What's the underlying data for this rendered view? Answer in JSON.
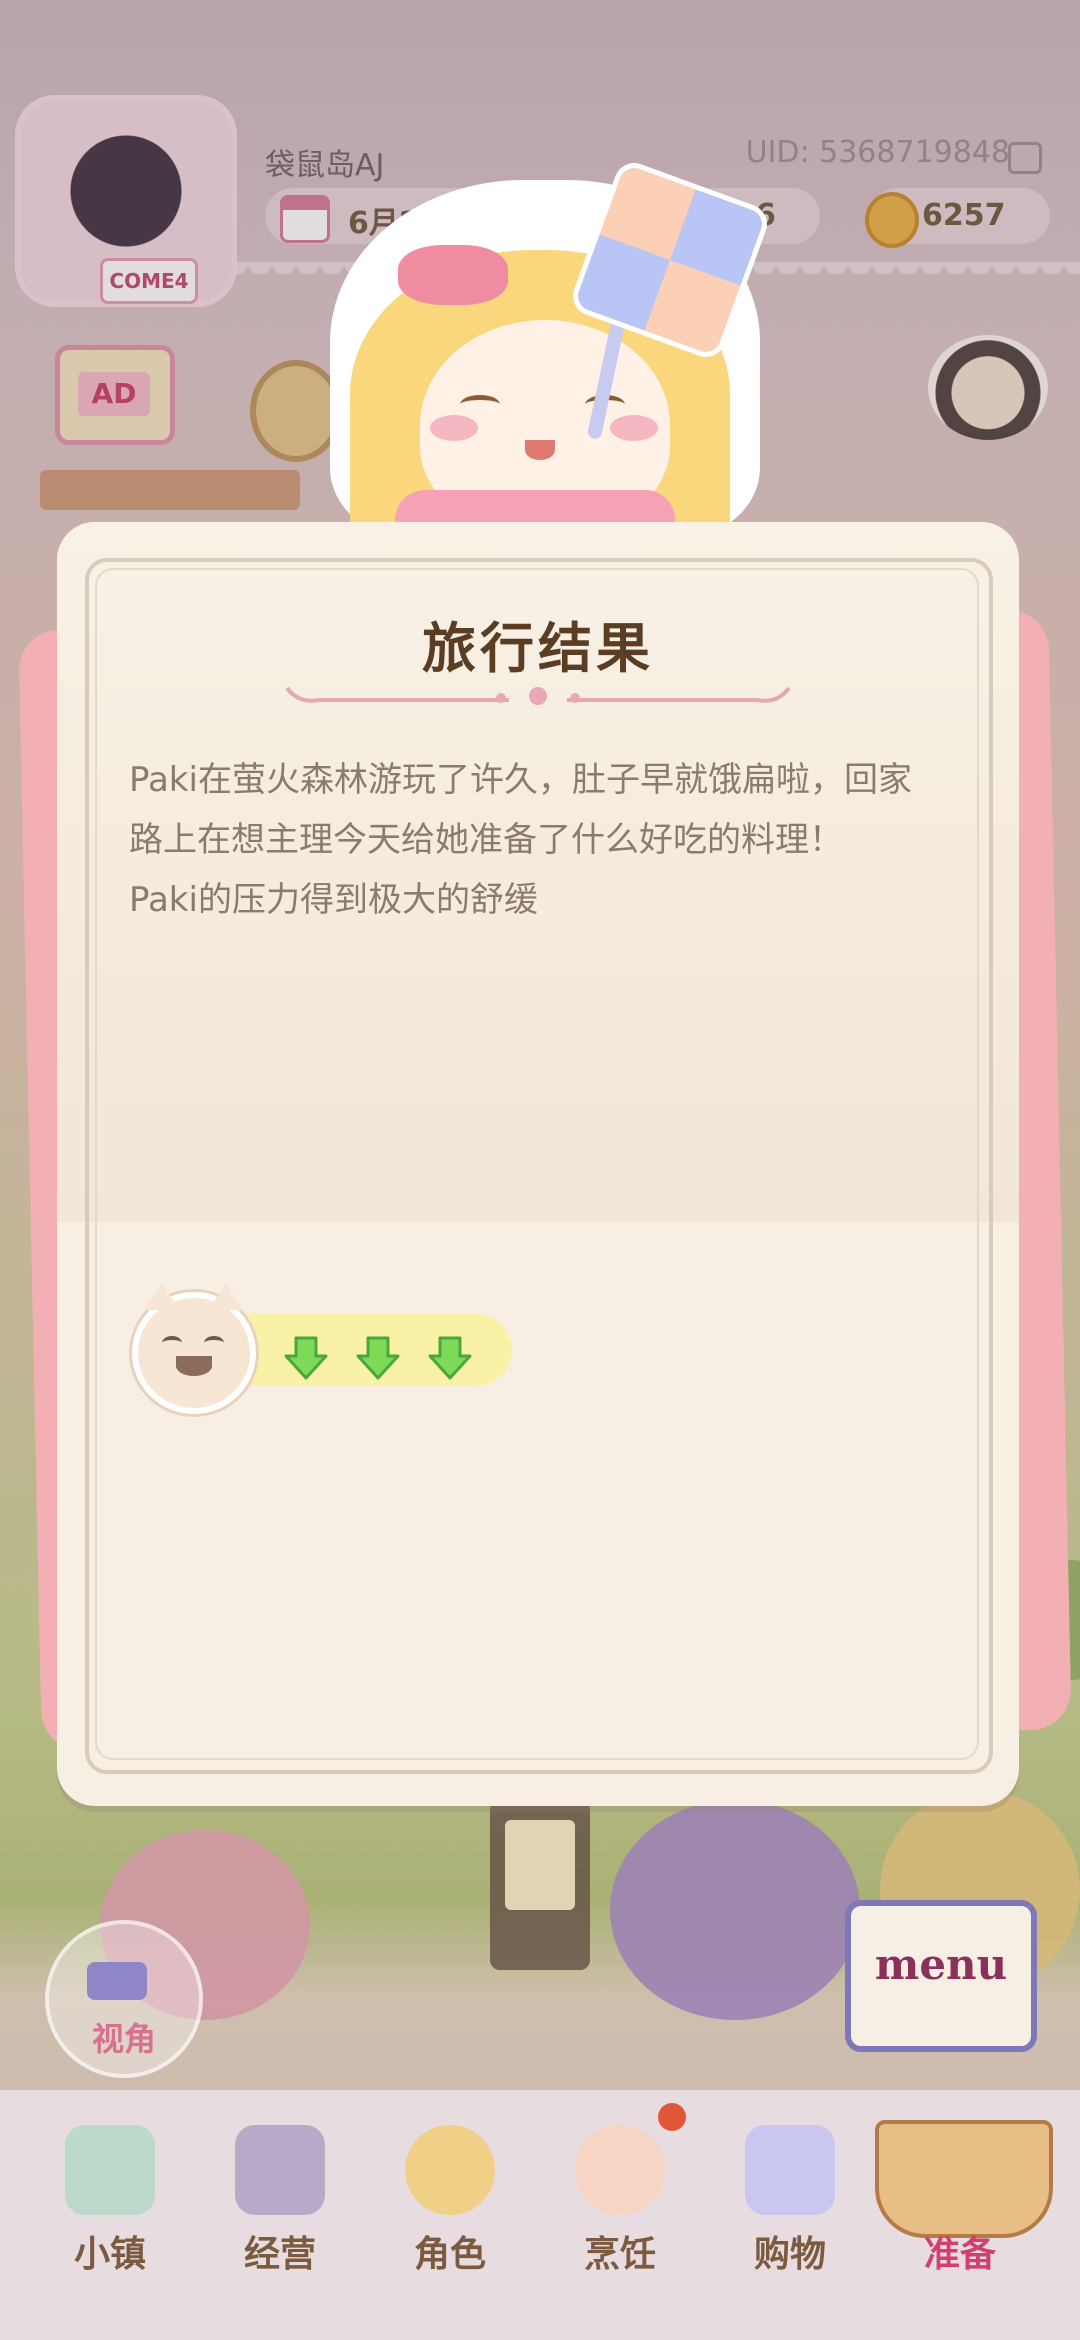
{
  "profile": {
    "avatar_badge": "COME4",
    "username": "袋鼠岛AJ",
    "uid": "UID: 5368719848"
  },
  "status": {
    "date": "6月26日",
    "middle_value": "6",
    "coins": "6257"
  },
  "side_buttons": {
    "ad_label": "AD"
  },
  "dialog": {
    "title": "旅行结果",
    "message_lines": [
      "Paki在萤火森林游玩了许久，肚子早就饿扁啦，回家",
      "路上在想主理今天给她准备了什么好吃的料理！",
      "Paki的压力得到极大的舒缓"
    ],
    "stress_change": {
      "arrows": 3,
      "direction": "down",
      "arrow_color": "#7ed957"
    }
  },
  "camera": {
    "label": "视角"
  },
  "menu": {
    "label": "menu"
  },
  "nav": {
    "items": [
      {
        "label": "小镇",
        "icon": "map-icon"
      },
      {
        "label": "经营",
        "icon": "locked-hat-icon"
      },
      {
        "label": "角色",
        "icon": "character-icon"
      },
      {
        "label": "烹饪",
        "icon": "sandwich-icon"
      },
      {
        "label": "购物",
        "icon": "shopping-bag-icon"
      },
      {
        "label": "准备",
        "icon": "picnic-basket-icon"
      }
    ],
    "active": "准备",
    "badge_on": "烹饪"
  },
  "colors": {
    "title": "#5a3d22",
    "text": "#8b7a6f",
    "active_nav": "#d23f70",
    "nav": "#7b5a3f",
    "dialog_bg": "#f7efe4"
  }
}
